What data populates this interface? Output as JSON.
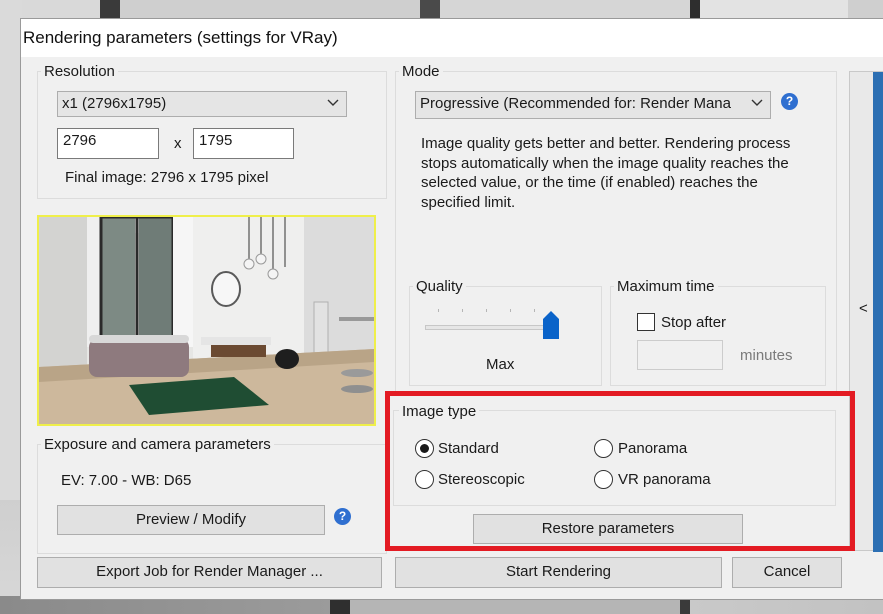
{
  "dialog": {
    "title": "Rendering parameters (settings for VRay)"
  },
  "resolution": {
    "label": "Resolution",
    "preset": "x1 (2796x1795)",
    "width": "2796",
    "separator": "x",
    "height": "1795",
    "final_image": "Final image: 2796 x 1795 pixel"
  },
  "mode": {
    "label": "Mode",
    "selected": "Progressive (Recommended for: Render Mana",
    "description": "Image quality gets better and better. Rendering process stops automatically when the image quality reaches the selected value, or the time (if enabled) reaches the specified limit."
  },
  "quality": {
    "label": "Quality",
    "value_label": "Max",
    "level_fraction": 1.0
  },
  "max_time": {
    "label": "Maximum time",
    "stop_after_label": "Stop after",
    "stop_after_checked": false,
    "minutes_value": "",
    "minutes_label": "minutes"
  },
  "exposure": {
    "label": "Exposure and camera parameters",
    "value": "EV: 7.00 - WB: D65",
    "preview_button": "Preview / Modify"
  },
  "image_type": {
    "label": "Image type",
    "options": [
      {
        "label": "Standard",
        "checked": true
      },
      {
        "label": "Panorama",
        "checked": false
      },
      {
        "label": "Stereoscopic",
        "checked": false
      },
      {
        "label": "VR panorama",
        "checked": false
      }
    ],
    "restore_button": "Restore parameters"
  },
  "footer": {
    "export_button": "Export Job for Render Manager ...",
    "start_button": "Start Rendering",
    "cancel_button": "Cancel"
  },
  "side_panel": {
    "arrow": "<"
  },
  "help_icon_glyph": "?",
  "colors": {
    "highlight": "#e31b23",
    "help_icon": "#2f6fd0",
    "slider_thumb": "#0a63c9",
    "preview_border": "#efef4a",
    "side_strip": "#2c6fb3"
  }
}
